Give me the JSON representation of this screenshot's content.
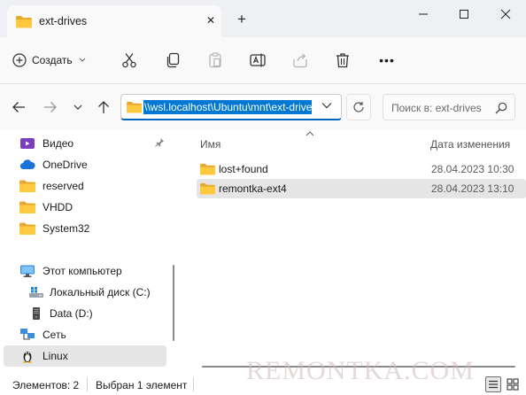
{
  "window": {
    "tab_title": "ext-drives",
    "new_tab": "+",
    "tab_close": "✕"
  },
  "toolbar": {
    "create_label": "Создать",
    "more": "•••"
  },
  "address": {
    "path": "\\\\wsl.localhost\\Ubuntu\\mnt\\ext-drives",
    "search_placeholder": "Поиск в: ext-drives"
  },
  "sidebar": {
    "items": [
      {
        "label": "Видео",
        "icon": "video-icon",
        "pinned": true
      },
      {
        "label": "OneDrive",
        "icon": "onedrive-cloud-icon"
      },
      {
        "label": "reserved",
        "icon": "folder-icon"
      },
      {
        "label": "VHDD",
        "icon": "folder-icon"
      },
      {
        "label": "System32",
        "icon": "folder-icon"
      },
      {
        "label": "Этот компьютер",
        "icon": "computer-icon"
      },
      {
        "label": "Локальный диск (C:)",
        "icon": "windows-drive-icon"
      },
      {
        "label": "Data (D:)",
        "icon": "drive-icon"
      },
      {
        "label": "Сеть",
        "icon": "network-icon"
      },
      {
        "label": "Linux",
        "icon": "linux-penguin-icon",
        "selected": true
      }
    ]
  },
  "content": {
    "columns": {
      "name": "Имя",
      "date": "Дата изменения"
    },
    "rows": [
      {
        "name": "lost+found",
        "date": "28.04.2023 10:30"
      },
      {
        "name": "remontka-ext4",
        "date": "28.04.2023 13:10",
        "selected": true
      }
    ]
  },
  "status": {
    "count": "Элементов: 2",
    "selection": "Выбран 1 элемент"
  },
  "watermark": "REMONTKA.COM",
  "colors": {
    "accent": "#0078d4",
    "folder": "#ffc83d",
    "selection": "#e5e5e5"
  }
}
